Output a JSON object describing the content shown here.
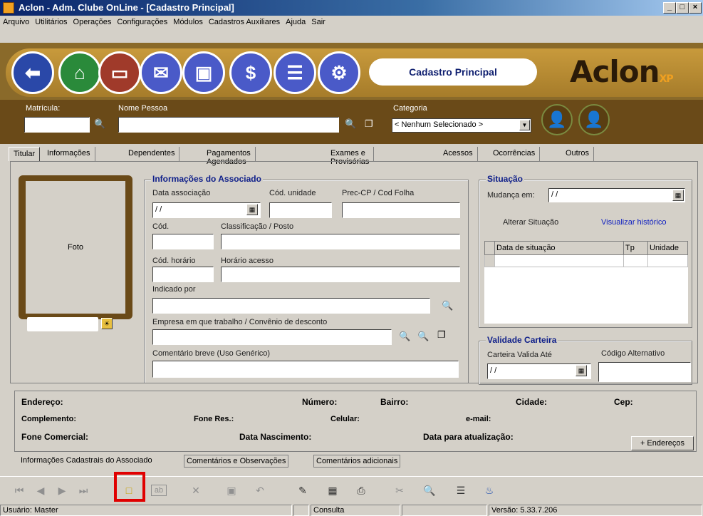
{
  "window": {
    "title": "Aclon - Adm. Clube OnLine - [Cadastro Principal]",
    "controls": [
      "_",
      "□",
      "×"
    ]
  },
  "menu": [
    "Arquivo",
    "Utilitários",
    "Operações",
    "Configurações",
    "Módulos",
    "Cadastros Auxiliares",
    "Ajuda",
    "Sair"
  ],
  "header": {
    "module_title": "Cadastro Principal",
    "logo": "Aclon",
    "logo_suffix": "XP",
    "nav_icons": [
      "back-arrow-icon",
      "home-icon",
      "card-icon",
      "mail-icon",
      "computer-icon",
      "dollar-icon",
      "documents-icon",
      "settings-document-icon"
    ]
  },
  "search": {
    "matricula_label": "Matrícula:",
    "nome_label": "Nome Pessoa",
    "categoria_label": "Categoria",
    "categoria_value": "< Nenhum Selecionado >",
    "binoculars": "🔭"
  },
  "tabs": [
    "Titular",
    "Informações",
    "Dependentes",
    "Pagamentos Agendados",
    "Exames e Provisórias",
    "Acessos",
    "Ocorrências",
    "Outros"
  ],
  "photo": {
    "label": "Foto"
  },
  "info": {
    "group_title": "Informações do Associado",
    "data_associacao": "Data associação",
    "data_associacao_value": "/ /",
    "cod_unidade": "Cód. unidade",
    "prec_cp": "Prec-CP / Cod Folha",
    "cod": "Cód.",
    "classificacao": "Classificação / Posto",
    "cod_horario": "Cód. horário",
    "horario_acesso": "Horário acesso",
    "indicado_por": "Indicado por",
    "empresa": "Empresa em que trabalho / Convênio de desconto",
    "comentario": "Comentário breve (Uso Genérico)"
  },
  "situacao": {
    "group_title": "Situação",
    "mudanca_label": "Mudança em:",
    "mudanca_value": "/ /",
    "alterar": "Alterar Situação",
    "visualizar": "Visualizar histórico",
    "columns": [
      "Data de situação",
      "Tp",
      "Unidade"
    ]
  },
  "validade": {
    "group_title": "Validade Carteira",
    "valida_ate": "Carteira Valida Até",
    "valida_value": "/ /",
    "codigo_alt": "Código Alternativo"
  },
  "address": {
    "endereco": "Endereço:",
    "numero": "Número:",
    "bairro": "Bairro:",
    "cidade": "Cidade:",
    "cep": "Cep:",
    "complemento": "Complemento:",
    "fone_res": "Fone Res.:",
    "celular": "Celular:",
    "email": "e-mail:",
    "fone_com": "Fone Comercial:",
    "data_nasc": "Data Nascimento:",
    "data_atual": "Data para atualização:",
    "mais_enderecos": "+ Endereços"
  },
  "bottom_tabs": [
    "Informações Cadastrais do Associado",
    "Comentários e Observações",
    "Comentários adicionais"
  ],
  "statusbar": {
    "usuario": "Usuário: Master",
    "modo": "Consulta",
    "versao": "Versão: 5.33.7.206"
  }
}
